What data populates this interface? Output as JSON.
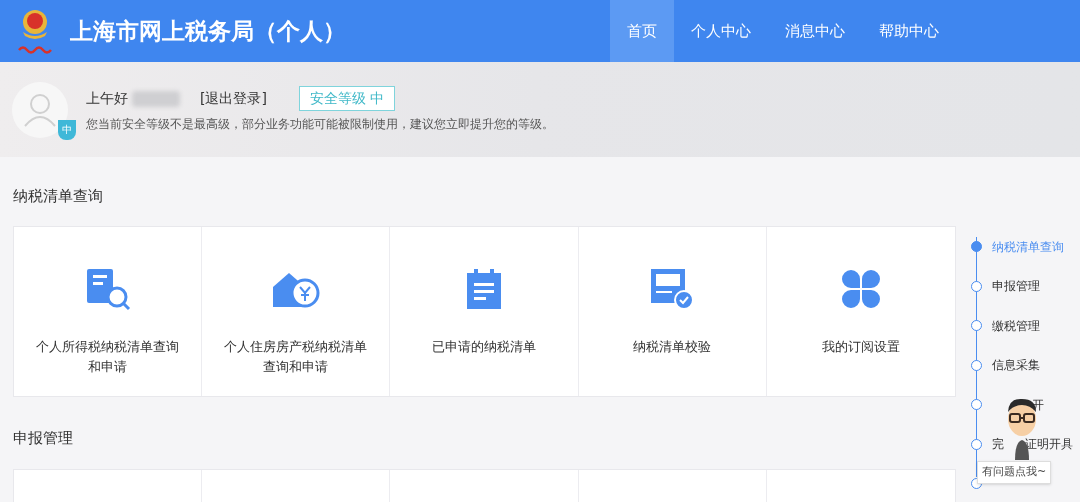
{
  "header": {
    "title": "上海市网上税务局（个人）",
    "nav": [
      {
        "label": "首页",
        "selected": true
      },
      {
        "label": "个人中心",
        "selected": false
      },
      {
        "label": "消息中心",
        "selected": false
      },
      {
        "label": "帮助中心",
        "selected": false
      }
    ]
  },
  "profile": {
    "greeting": "上午好",
    "logout": "[退出登录]",
    "security_badge": "安全等级 中",
    "shield_label": "中",
    "notice": "您当前安全等级不是最高级，部分业务功能可能被限制使用，建议您立即提升您的等级。"
  },
  "sections": [
    {
      "title": "纳税清单查询",
      "cards": [
        {
          "kind": "search-doc",
          "label": "个人所得税纳税清单查询和申请"
        },
        {
          "kind": "house",
          "label": "个人住房房产税纳税清单查询和申请"
        },
        {
          "kind": "clipboard",
          "label": "已申请的纳税清单"
        },
        {
          "kind": "verify",
          "label": "纳税清单校验"
        },
        {
          "kind": "clover",
          "label": "我的订阅设置"
        }
      ]
    },
    {
      "title": "申报管理",
      "cards": [
        {
          "kind": "empty"
        },
        {
          "kind": "empty"
        },
        {
          "kind": "empty"
        },
        {
          "kind": "empty"
        },
        {
          "kind": "empty"
        }
      ]
    }
  ],
  "timeline": [
    {
      "parts": [
        {
          "text": "纳税清单查询"
        }
      ],
      "selected": true
    },
    {
      "parts": [
        {
          "text": "申报管理"
        }
      ],
      "selected": false
    },
    {
      "parts": [
        {
          "text": "缴税管理"
        }
      ],
      "selected": false
    },
    {
      "parts": [
        {
          "text": "信息采集"
        }
      ],
      "selected": false
    },
    {
      "parts": [
        {
          "text": "开",
          "covered_before": true
        }
      ],
      "selected": false
    },
    {
      "parts": [
        {
          "text": "完"
        },
        {
          "text": "证明开具",
          "covered_before": true
        }
      ],
      "selected": false
    },
    {
      "selected": false
    }
  ],
  "helper": {
    "tooltip": "有问题点我~"
  }
}
